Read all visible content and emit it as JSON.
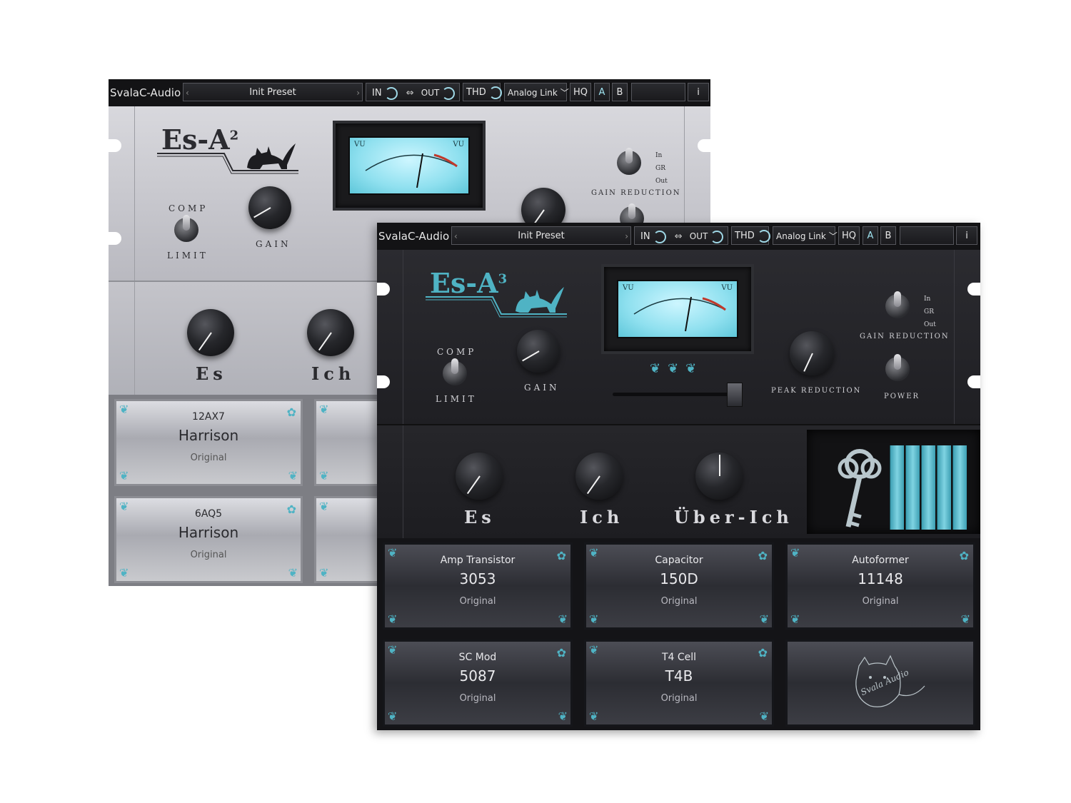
{
  "back_plugin": {
    "brand": "SvalaC-Audio",
    "preset": "Init Preset",
    "in_label": "IN",
    "link_icon": "link-icon",
    "out_label": "OUT",
    "thd_label": "THD",
    "analog_link": "Analog Link",
    "hq_label": "HQ",
    "a_label": "A",
    "b_label": "B",
    "info_label": "i",
    "logo": "Es-A",
    "logo_sup": "2",
    "vu_left": "VU",
    "vu_right": "VU",
    "comp_label": "COMP",
    "limit_label": "LIMIT",
    "gain_label": "GAIN",
    "gr_in": "In",
    "gr_gr": "GR",
    "gr_out": "Out",
    "gain_reduction_label": "GAIN REDUCTION",
    "knob_es": "Es",
    "knob_ich": "Ich",
    "cards": [
      {
        "type": "12AX7",
        "model": "Harrison",
        "variant": "Original"
      },
      {
        "type": "6AQ5",
        "model": "Harrison",
        "variant": "Original"
      }
    ]
  },
  "front_plugin": {
    "brand": "SvalaC-Audio",
    "preset": "Init Preset",
    "in_label": "IN",
    "out_label": "OUT",
    "thd_label": "THD",
    "analog_link": "Analog Link",
    "hq_label": "HQ",
    "a_label": "A",
    "b_label": "B",
    "info_label": "i",
    "logo": "Es-A",
    "logo_sup": "3",
    "vu_left": "VU",
    "vu_right": "VU",
    "comp_label": "COMP",
    "limit_label": "LIMIT",
    "gain_label": "GAIN",
    "peak_reduction_label": "PEAK REDUCTION",
    "gr_in": "In",
    "gr_gr": "GR",
    "gr_out": "Out",
    "gain_reduction_label": "GAIN REDUCTION",
    "power_label": "POWER",
    "knob_es": "Es",
    "knob_ich": "Ich",
    "knob_ueber_ich": "Über-Ich",
    "cards": [
      {
        "type": "Amp Transistor",
        "model": "3053",
        "variant": "Original"
      },
      {
        "type": "Capacitor",
        "model": "150D",
        "variant": "Original"
      },
      {
        "type": "Autoformer",
        "model": "11148",
        "variant": "Original"
      },
      {
        "type": "SC Mod",
        "model": "5087",
        "variant": "Original"
      },
      {
        "type": "T4 Cell",
        "model": "T4B",
        "variant": "Original"
      }
    ],
    "signature": "Svala Audio"
  },
  "colors": {
    "accent": "#4fb3c4",
    "vu_screen": "#8fe0ef",
    "dark_face": "#232327",
    "silver_face": "#c9c9cf"
  }
}
